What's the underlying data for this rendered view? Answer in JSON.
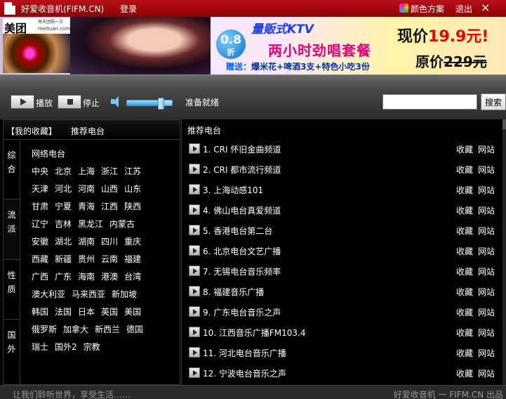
{
  "titlebar": {
    "title": "好爱收音机(FIFM.CN)",
    "login": "登录",
    "theme": "颜色方案",
    "logout": "退出",
    "close": "×"
  },
  "banner": {
    "brand": "美团",
    "slogan": "每天团购一次",
    "domain": "meituan.com",
    "discount_num": "0.8",
    "discount_unit": "折",
    "headline": "量贩式KTV",
    "subline": "两小时劲唱套餐",
    "gift_label": "赠送：",
    "gift_items": "爆米花+啤酒3支+特色小吃3份",
    "price_now_label": "现价",
    "price_now_value": "19.9元!",
    "price_old_label": "原价",
    "price_old_value": "229元"
  },
  "controls": {
    "play_label": "播放",
    "stop_label": "停止",
    "volume": 0.75,
    "status": "准备就绪",
    "search_value": "",
    "search_button": "搜索"
  },
  "leftpanel": {
    "tab_favorites": "【我的收藏】",
    "tab_recommended": "推荐电台",
    "sidetabs": [
      {
        "chars": [
          "综",
          "合"
        ]
      },
      {
        "chars": [
          "流",
          "派"
        ]
      },
      {
        "chars": [
          "性",
          "质"
        ]
      },
      {
        "chars": [
          "国",
          "外"
        ]
      }
    ],
    "rows": [
      [
        "网络电台"
      ],
      [
        "中央",
        "北京",
        "上海",
        "浙江",
        "江苏"
      ],
      [
        "天津",
        "河北",
        "河南",
        "山西",
        "山东"
      ],
      [
        "甘肃",
        "宁夏",
        "青海",
        "江西",
        "陕西"
      ],
      [
        "辽宁",
        "吉林",
        "黑龙江",
        "内蒙古"
      ],
      [
        "安徽",
        "湖北",
        "湖南",
        "四川",
        "重庆"
      ],
      [
        "西藏",
        "新疆",
        "贵州",
        "云南",
        "福建"
      ],
      [
        "广西",
        "广东",
        "海南",
        "港澳",
        "台湾"
      ],
      [
        "澳大利亚",
        "马来西亚",
        "新加坡"
      ],
      [
        "韩国",
        "法国",
        "日本",
        "英国",
        "美国"
      ],
      [
        "俄罗斯",
        "加拿大",
        "新西兰",
        "德国"
      ],
      [
        "瑞士",
        "国外2",
        "宗教"
      ]
    ]
  },
  "rightpanel": {
    "header": "推荐电台",
    "fav_label": "收藏",
    "site_label": "网站",
    "stations": [
      "1. CRI 怀旧金曲频道",
      "2. CRI 都市流行频道",
      "3. 上海动感101",
      "4. 佛山电台真爱频道",
      "5. 香港电台第二台",
      "6. 北京电台文艺广播",
      "7. 无锡电台音乐频率",
      "8. 福建音乐广播",
      "9. 广东电台音乐之声",
      "10. 江西音乐广播FM103.4",
      "11. 河北电台音乐广播",
      "12. 宁波电台音乐之声"
    ]
  },
  "statusbar": {
    "left": "让我们聆听世界，享受生活……",
    "right": "好爱收音机 一 FIFM.CN 出品"
  }
}
